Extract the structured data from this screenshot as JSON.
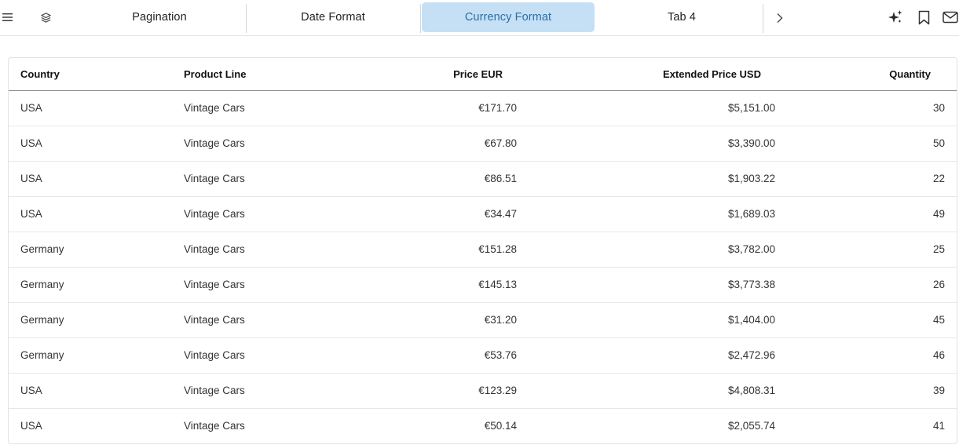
{
  "tabs": [
    {
      "label": "Pagination"
    },
    {
      "label": "Date Format"
    },
    {
      "label": "Currency Format"
    },
    {
      "label": "Tab 4"
    }
  ],
  "active_tab": "Currency Format",
  "icons": {
    "menu": "hamburger-icon",
    "layers": "layers-icon",
    "next": "chevron-right-icon",
    "ai": "sparkle-icon",
    "bookmark": "bookmark-icon",
    "mail": "mail-icon"
  },
  "colors": {
    "active_tab_bg": "#c5e0f5",
    "active_tab_text": "#2a6fa8"
  },
  "table": {
    "columns": [
      "Country",
      "Product Line",
      "Price EUR",
      "Extended Price USD",
      "Quantity"
    ],
    "rows": [
      [
        "USA",
        "Vintage Cars",
        "€171.70",
        "$5,151.00",
        "30"
      ],
      [
        "USA",
        "Vintage Cars",
        "€67.80",
        "$3,390.00",
        "50"
      ],
      [
        "USA",
        "Vintage Cars",
        "€86.51",
        "$1,903.22",
        "22"
      ],
      [
        "USA",
        "Vintage Cars",
        "€34.47",
        "$1,689.03",
        "49"
      ],
      [
        "Germany",
        "Vintage Cars",
        "€151.28",
        "$3,782.00",
        "25"
      ],
      [
        "Germany",
        "Vintage Cars",
        "€145.13",
        "$3,773.38",
        "26"
      ],
      [
        "Germany",
        "Vintage Cars",
        "€31.20",
        "$1,404.00",
        "45"
      ],
      [
        "Germany",
        "Vintage Cars",
        "€53.76",
        "$2,472.96",
        "46"
      ],
      [
        "USA",
        "Vintage Cars",
        "€123.29",
        "$4,808.31",
        "39"
      ],
      [
        "USA",
        "Vintage Cars",
        "€50.14",
        "$2,055.74",
        "41"
      ]
    ]
  }
}
